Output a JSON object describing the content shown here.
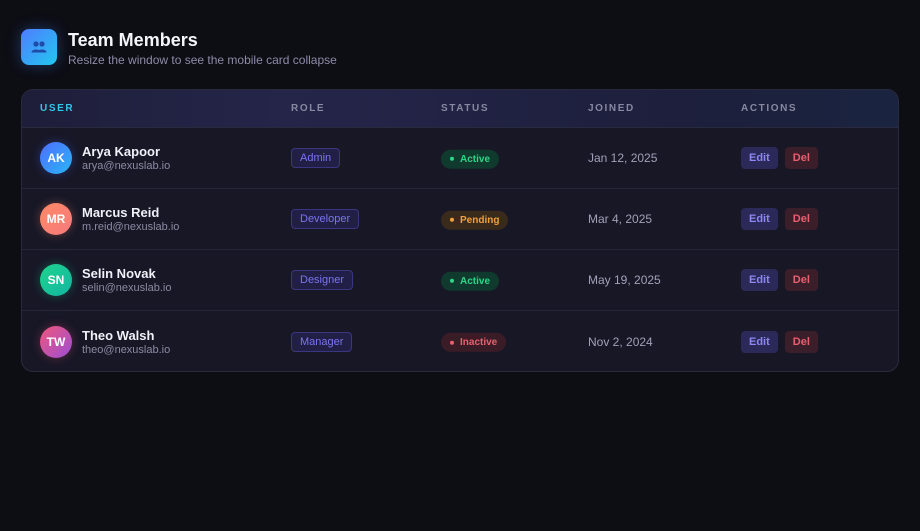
{
  "header": {
    "title": "Team Members",
    "subtitle": "Resize the window to see the mobile card collapse",
    "icon": "users-icon"
  },
  "table": {
    "columns": [
      "USER",
      "ROLE",
      "STATUS",
      "JOINED",
      "ACTIONS"
    ],
    "rows": [
      {
        "initials": "AK",
        "name": "Arya Kapoor",
        "email": "arya@nexuslab.io",
        "role": "Admin",
        "status": "Active",
        "joined": "Jan 12, 2025",
        "edit": "Edit",
        "del": "Del",
        "avatar_gradient": [
          "#4f6cff",
          "#29b6f6"
        ],
        "status_kind": "active"
      },
      {
        "initials": "MR",
        "name": "Marcus Reid",
        "email": "m.reid@nexuslab.io",
        "role": "Developer",
        "status": "Pending",
        "joined": "Mar 4, 2025",
        "edit": "Edit",
        "del": "Del",
        "avatar_gradient": [
          "#ff8a65",
          "#f7797d"
        ],
        "status_kind": "pending"
      },
      {
        "initials": "SN",
        "name": "Selin Novak",
        "email": "selin@nexuslab.io",
        "role": "Designer",
        "status": "Active",
        "joined": "May 19, 2025",
        "edit": "Edit",
        "del": "Del",
        "avatar_gradient": [
          "#1fd48c",
          "#13b5a3"
        ],
        "status_kind": "active"
      },
      {
        "initials": "TW",
        "name": "Theo Walsh",
        "email": "theo@nexuslab.io",
        "role": "Manager",
        "status": "Inactive",
        "joined": "Nov 2, 2024",
        "edit": "Edit",
        "del": "Del",
        "avatar_gradient": [
          "#f0567a",
          "#9b4fd6"
        ],
        "status_kind": "inactive"
      }
    ]
  },
  "colors": {
    "accent": "#2ec8f0",
    "active_bg": "#103a2e",
    "active_fg": "#2fd486",
    "pending_bg": "#3a2a1c",
    "pending_fg": "#f0a03c",
    "inactive_bg": "#3a1c26",
    "inactive_fg": "#e8606e"
  }
}
